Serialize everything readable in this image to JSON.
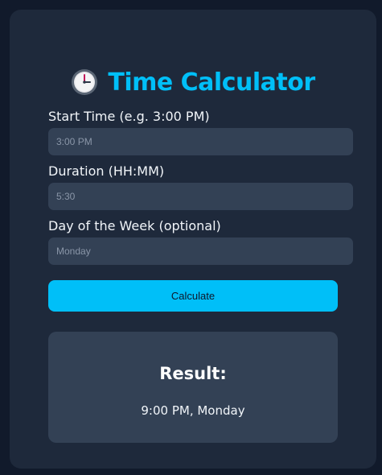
{
  "header": {
    "title": "Time Calculator",
    "icon": "clock-icon"
  },
  "form": {
    "start_time": {
      "label": "Start Time (e.g. 3:00 PM)",
      "placeholder": "3:00 PM",
      "value": ""
    },
    "duration": {
      "label": "Duration (HH:MM)",
      "placeholder": "5:30",
      "value": ""
    },
    "day_of_week": {
      "label": "Day of the Week (optional)",
      "placeholder": "Monday",
      "value": ""
    },
    "calculate_label": "Calculate"
  },
  "result": {
    "heading": "Result:",
    "value": "9:00 PM, Monday"
  },
  "colors": {
    "page_background": "#111a2b",
    "card_background": "#1e293b",
    "input_background": "#334155",
    "accent": "#00bff8",
    "text": "#f1f5f9"
  }
}
